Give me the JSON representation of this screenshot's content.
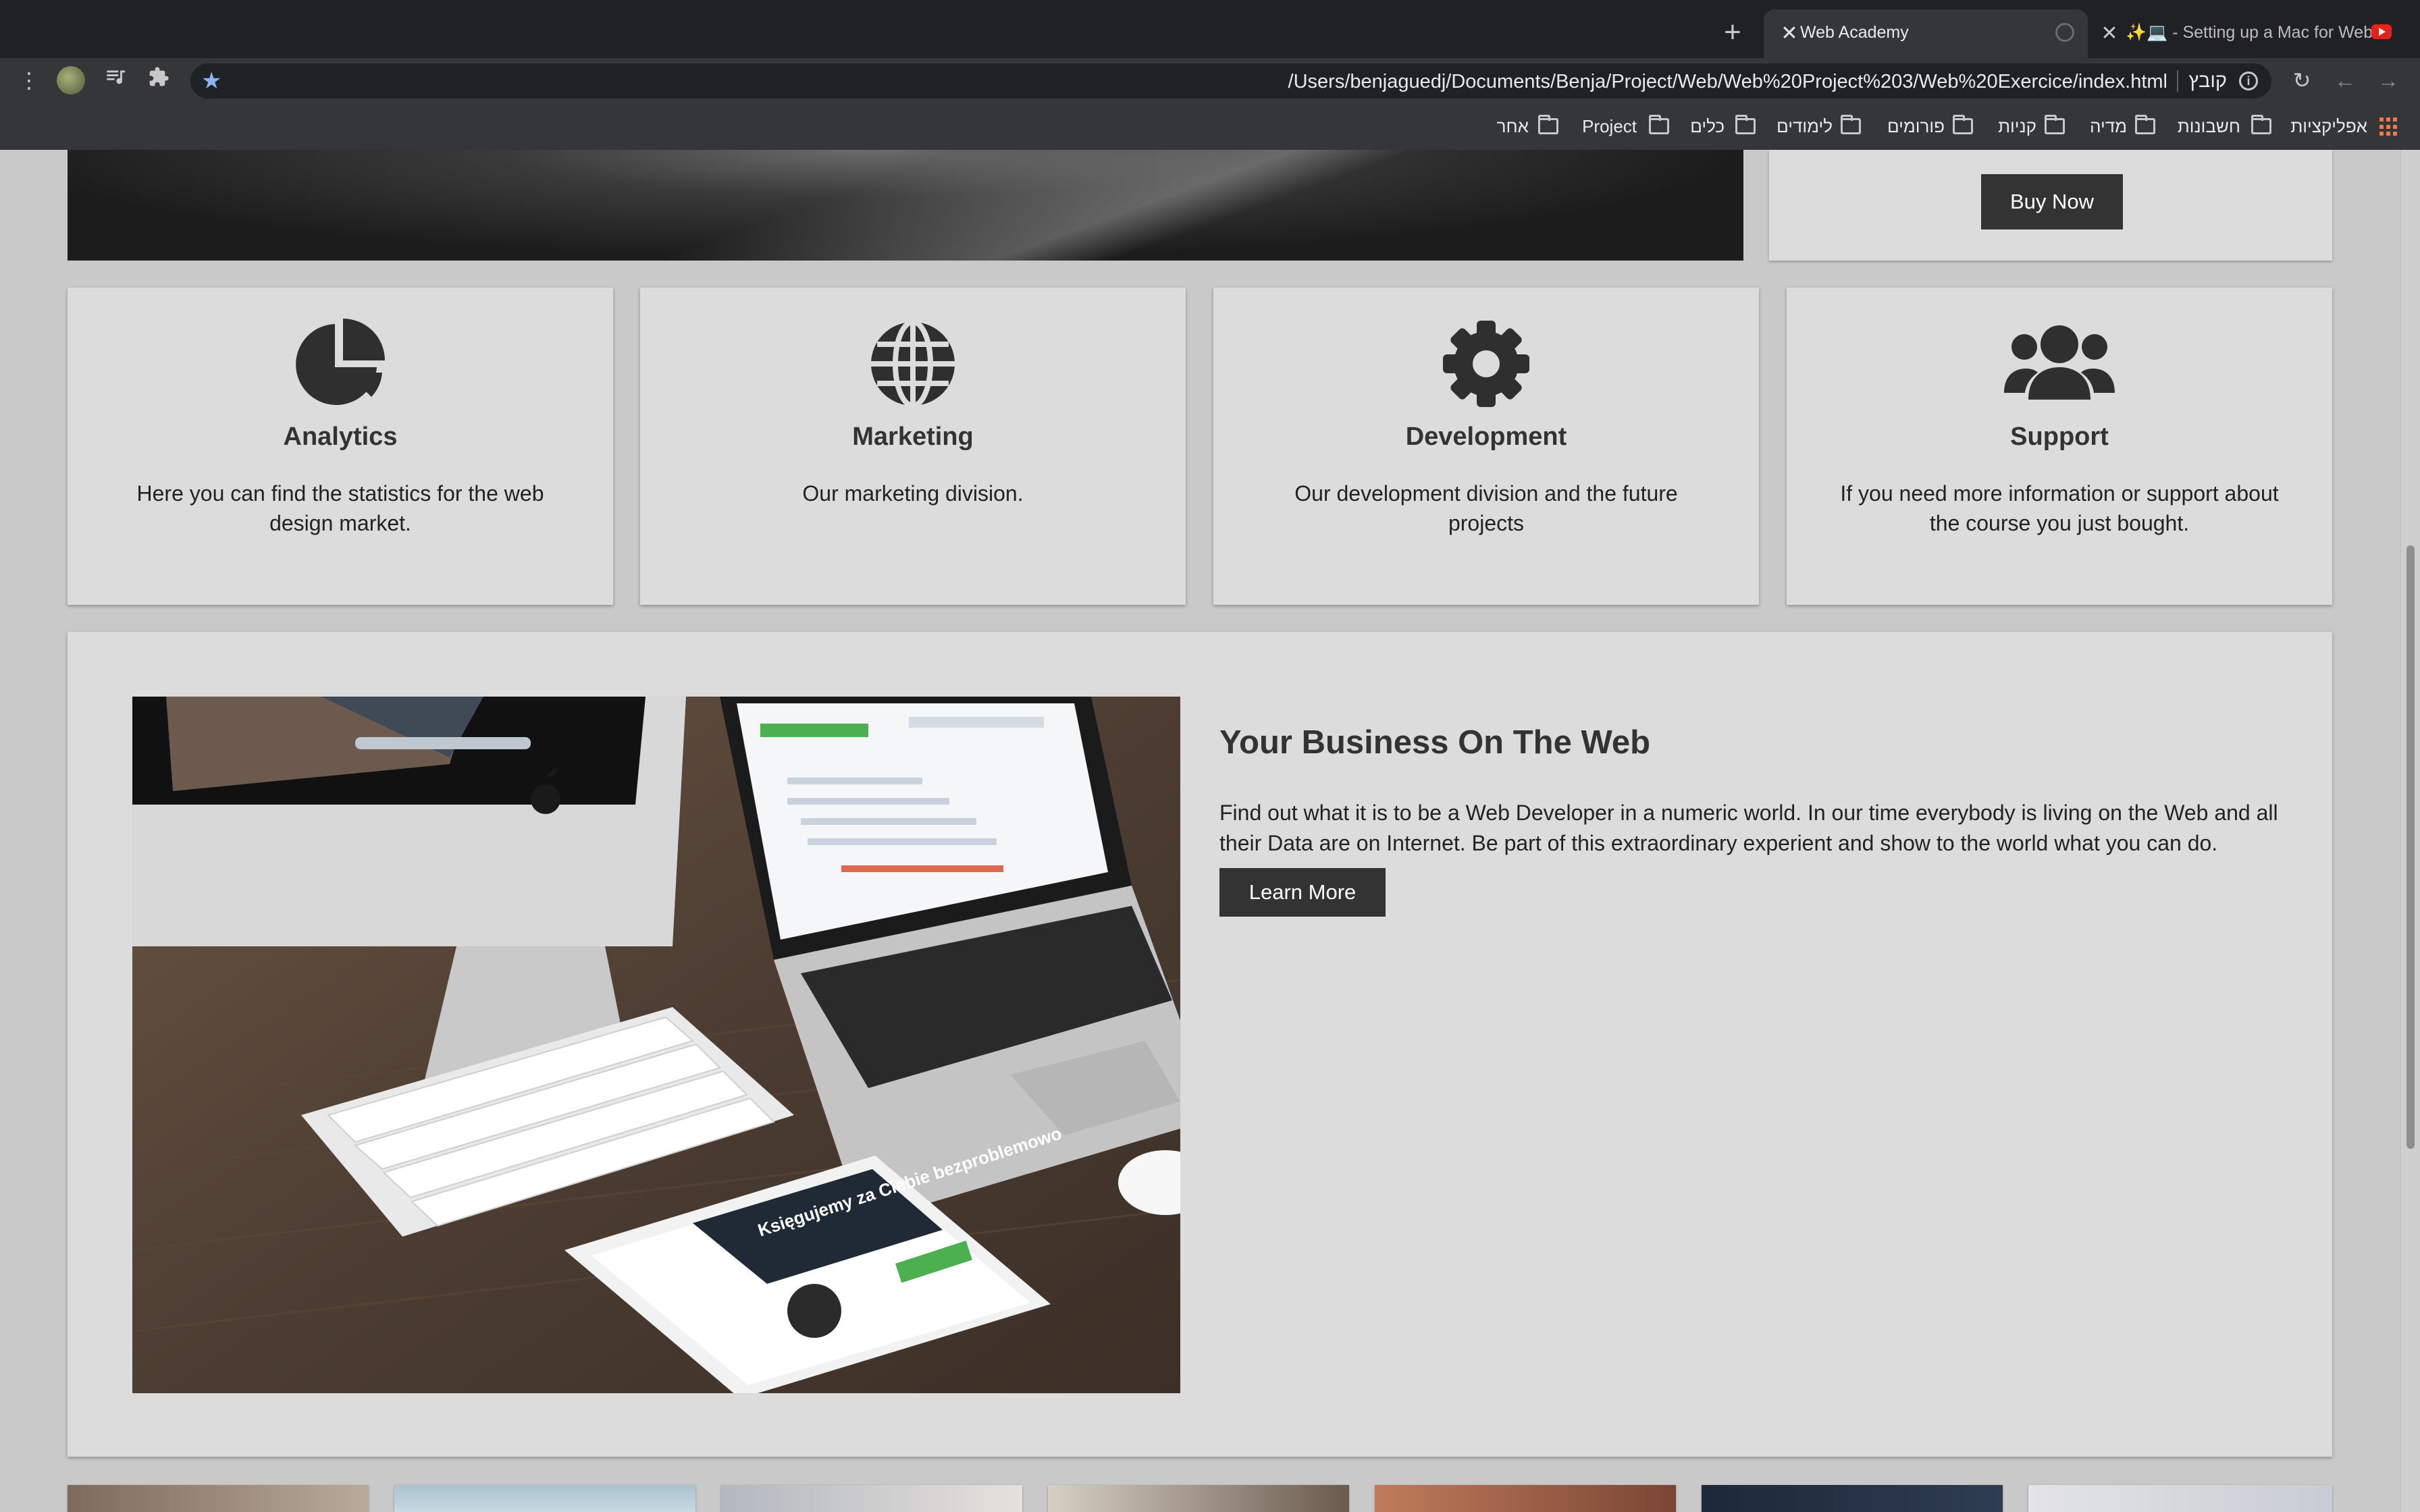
{
  "browser": {
    "tabs": [
      {
        "title": "Web Academy",
        "active": true
      },
      {
        "title": "✨💻 - Setting up a Mac for Web",
        "active": false
      }
    ],
    "new_tab_symbol": "+",
    "address": "/Users/benjaguedj/Documents/Benja/Project/Web/Web%20Project%203/Web%20Exercice/index.html",
    "scheme_label": "קובץ",
    "bookmarks": [
      "אפליקציות",
      "חשבונות",
      "מדיה",
      "קניות",
      "פורומים",
      "לימודים",
      "כלים",
      "Project",
      "אחר"
    ],
    "icons": {
      "menu": "kebab-menu-icon",
      "profile": "avatar-icon",
      "media": "media-queue-icon",
      "extensions": "puzzle-icon",
      "bookmark_star": "star-icon",
      "info": "info-icon",
      "reload": "reload-icon",
      "back": "arrow-left-icon",
      "forward": "arrow-right-icon",
      "apps": "apps-grid-icon"
    }
  },
  "page": {
    "buy_button": "Buy Now",
    "cards": [
      {
        "icon": "pie-chart-icon",
        "title": "Analytics",
        "text": "Here you can find the statistics for the web design market."
      },
      {
        "icon": "globe-icon",
        "title": "Marketing",
        "text": "Our marketing division."
      },
      {
        "icon": "gear-icon",
        "title": "Development",
        "text": "Our development division and the future projects"
      },
      {
        "icon": "users-icon",
        "title": "Support",
        "text": "If you need more information or support about the course you just bought."
      }
    ],
    "feature": {
      "title": "Your Business On The Web",
      "text": "Find out what it is to be a Web Developer in a numeric world. In our time everybody is living on the Web and all their Data are on Internet. Be part of this extraordinary experient and show to the world what you can do.",
      "button": "Learn More",
      "image_text": "Księgujemy za Ciebie bezproblemowo"
    }
  },
  "colors": {
    "chrome_dark": "#202124",
    "chrome_mid": "#35363a",
    "page_bg": "#c9c9c9",
    "card_bg": "#dcdcdc",
    "button_bg": "#333333",
    "text": "#333333"
  }
}
